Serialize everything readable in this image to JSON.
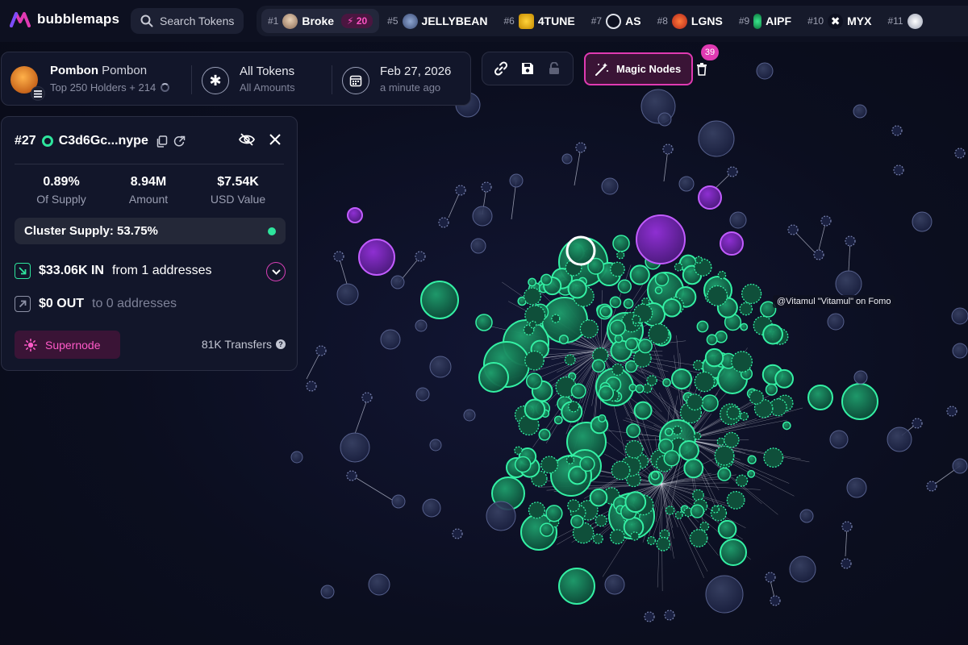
{
  "app": {
    "name": "bubblemaps"
  },
  "search": {
    "label": "Search Tokens"
  },
  "colors": {
    "accent": "#e03ab2",
    "green": "#2ee59d",
    "purple": "#a43dd9",
    "node_blue": "#2a3152"
  },
  "trending": [
    {
      "rank": "#1",
      "name": "Broke",
      "boost": "20",
      "icon": "avatar-icon"
    },
    {
      "rank": "#5",
      "name": "JELLYBEAN",
      "icon": "jellybean-icon"
    },
    {
      "rank": "#6",
      "name": "4TUNE",
      "icon": "4tune-icon"
    },
    {
      "rank": "#7",
      "name": "AS",
      "icon": "as-icon"
    },
    {
      "rank": "#8",
      "name": "LGNS",
      "icon": "lgns-icon"
    },
    {
      "rank": "#9",
      "name": "AIPF",
      "icon": "aipf-icon"
    },
    {
      "rank": "#10",
      "name": "MYX",
      "icon": "myx-icon"
    },
    {
      "rank": "#11",
      "name": "",
      "icon": "token-icon"
    }
  ],
  "token": {
    "name": "Pombon",
    "symbol": "Pombon",
    "holders": "Top 250 Holders + 214",
    "filter_title": "All Tokens",
    "filter_sub": "All Amounts",
    "date": "Feb 27, 2026",
    "updated": "a minute ago"
  },
  "toolbar": {
    "magic_label": "Magic Nodes",
    "magic_count": "39"
  },
  "panel": {
    "rank": "#27",
    "address": "C3d6Gc...nype",
    "stats": [
      {
        "value": "0.89%",
        "label": "Of Supply"
      },
      {
        "value": "8.94M",
        "label": "Amount"
      },
      {
        "value": "$7.54K",
        "label": "USD Value"
      }
    ],
    "cluster_supply": "Cluster Supply: 53.75%",
    "in_amount": "$33.06K IN",
    "in_text": "from 1 addresses",
    "out_amount": "$0 OUT",
    "out_text": "to 0 addresses",
    "supernode_label": "Supernode",
    "transfers": "81K Transfers"
  },
  "tooltip": {
    "text": "@Vitamul \"Vitamul\" on Fomo"
  }
}
